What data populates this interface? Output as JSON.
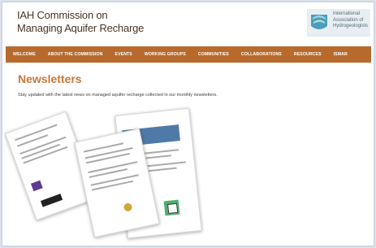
{
  "header": {
    "title_line1": "IAH Commission on",
    "title_line2": "Managing Aquifer Recharge",
    "logo_text": [
      "International",
      "Association of",
      "Hydrogeologists"
    ]
  },
  "nav": {
    "items": [
      "WELCOME",
      "ABOUT THE COMMISSION",
      "EVENTS",
      "WORKING GROUPS",
      "COMMUNITIES",
      "COLLABORATIONS",
      "RESOURCES",
      "ISMAR"
    ]
  },
  "main": {
    "title": "Newsletters",
    "intro": "Stay updated with the latest news on managed aquifer recharge collected in our monthly newsletters."
  },
  "colors": {
    "nav_bg": "#b86a2c",
    "title_color": "#c9783a"
  }
}
